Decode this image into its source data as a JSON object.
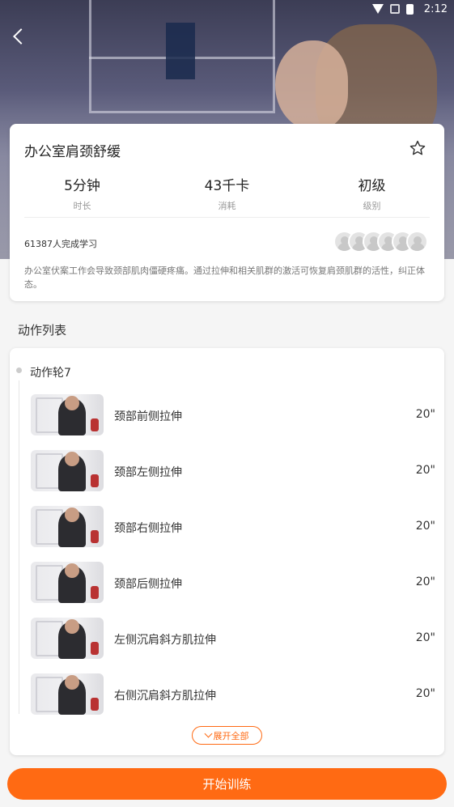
{
  "status_bar": {
    "time": "2:12",
    "icons": [
      "wifi-icon",
      "no-signal-icon",
      "battery-icon"
    ]
  },
  "header": {
    "back_icon": "chevron-left-icon"
  },
  "course": {
    "title": "办公室肩颈舒缓",
    "favorite_icon": "star-outline-icon",
    "stats": [
      {
        "value": "5分钟",
        "label": "时长"
      },
      {
        "value": "43千卡",
        "label": "消耗"
      },
      {
        "value": "初级",
        "label": "级别"
      }
    ],
    "learners": "61387人完成学习",
    "description": "办公室伏案工作会导致颈部肌肉僵硬疼痛。通过拉伸和相关肌群的激活可恢复肩颈肌群的活性，纠正体态。"
  },
  "list": {
    "section_title": "动作列表",
    "round_title": "动作轮7",
    "exercises": [
      {
        "name": "颈部前侧拉伸",
        "duration": "20\""
      },
      {
        "name": "颈部左侧拉伸",
        "duration": "20\""
      },
      {
        "name": "颈部右侧拉伸",
        "duration": "20\""
      },
      {
        "name": "颈部后侧拉伸",
        "duration": "20\""
      },
      {
        "name": "左侧沉肩斜方肌拉伸",
        "duration": "20\""
      },
      {
        "name": "右侧沉肩斜方肌拉伸",
        "duration": "20\""
      }
    ],
    "expand_label": "展开全部"
  },
  "footer": {
    "start_label": "开始训练"
  },
  "colors": {
    "accent": "#ff6a13",
    "background": "#f5f5f5",
    "card": "#ffffff"
  }
}
